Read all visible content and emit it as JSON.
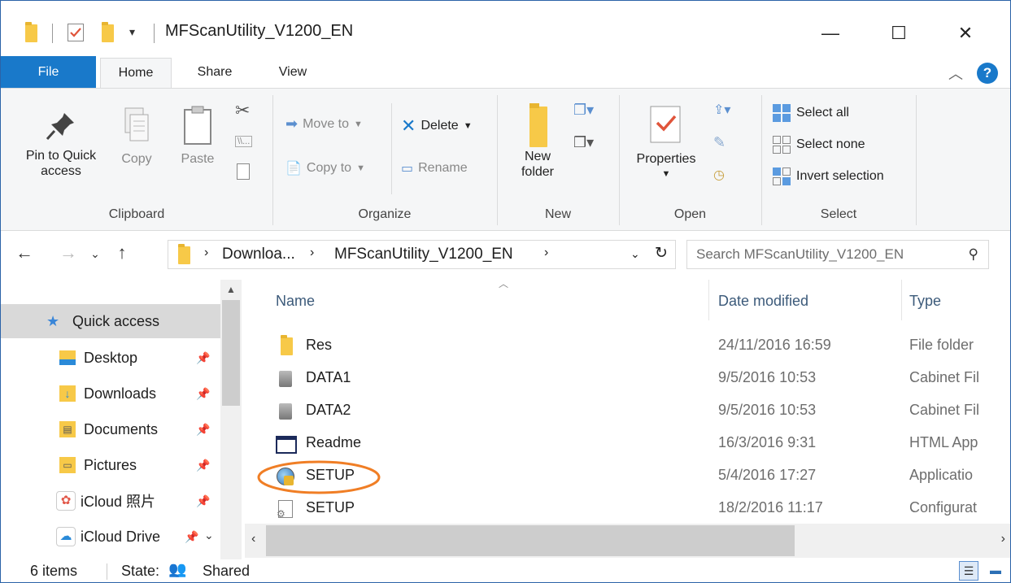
{
  "window": {
    "title": "MFScanUtility_V1200_EN",
    "minimize": "—",
    "maximize": "☐",
    "close": "✕"
  },
  "ribbon_tabs": [
    "File",
    "Home",
    "Share",
    "View"
  ],
  "ribbon": {
    "clipboard": {
      "label": "Clipboard",
      "pin_line1": "Pin to Quick",
      "pin_line2": "access",
      "copy": "Copy",
      "paste": "Paste"
    },
    "organize": {
      "label": "Organize",
      "move_to": "Move to",
      "copy_to": "Copy to",
      "delete": "Delete",
      "rename": "Rename"
    },
    "new": {
      "label": "New",
      "new_folder_line1": "New",
      "new_folder_line2": "folder"
    },
    "open": {
      "label": "Open",
      "properties": "Properties"
    },
    "select": {
      "label": "Select",
      "select_all": "Select all",
      "select_none": "Select none",
      "invert_selection": "Invert selection"
    }
  },
  "address": {
    "crumb1": "Downloa...",
    "crumb2": "MFScanUtility_V1200_EN",
    "search_placeholder": "Search MFScanUtility_V1200_EN"
  },
  "nav": {
    "quick_access": "Quick access",
    "items": [
      "Desktop",
      "Downloads",
      "Documents",
      "Pictures",
      "iCloud 照片",
      "iCloud Drive"
    ]
  },
  "columns": {
    "name": "Name",
    "date": "Date modified",
    "type": "Type"
  },
  "files": [
    {
      "name": "Res",
      "date": "24/11/2016 16:59",
      "type": "File folder",
      "icon": "folder-icon"
    },
    {
      "name": "DATA1",
      "date": "9/5/2016 10:53",
      "type": "Cabinet Fil",
      "icon": "cabinet-file-icon"
    },
    {
      "name": "DATA2",
      "date": "9/5/2016 10:53",
      "type": "Cabinet Fil",
      "icon": "cabinet-file-icon"
    },
    {
      "name": "Readme",
      "date": "16/3/2016 9:31",
      "type": "HTML App",
      "icon": "html-app-icon"
    },
    {
      "name": "SETUP",
      "date": "5/4/2016 17:27",
      "type": "Applicatio",
      "icon": "setup-app-icon"
    },
    {
      "name": "SETUP",
      "date": "18/2/2016 11:17",
      "type": "Configurat",
      "icon": "config-file-icon"
    }
  ],
  "status": {
    "count": "6 items",
    "state_label": "State:",
    "state_value": "Shared"
  },
  "colors": {
    "accent": "#1979ca",
    "highlight_ring": "#f07e25",
    "folder": "#f7c948"
  }
}
